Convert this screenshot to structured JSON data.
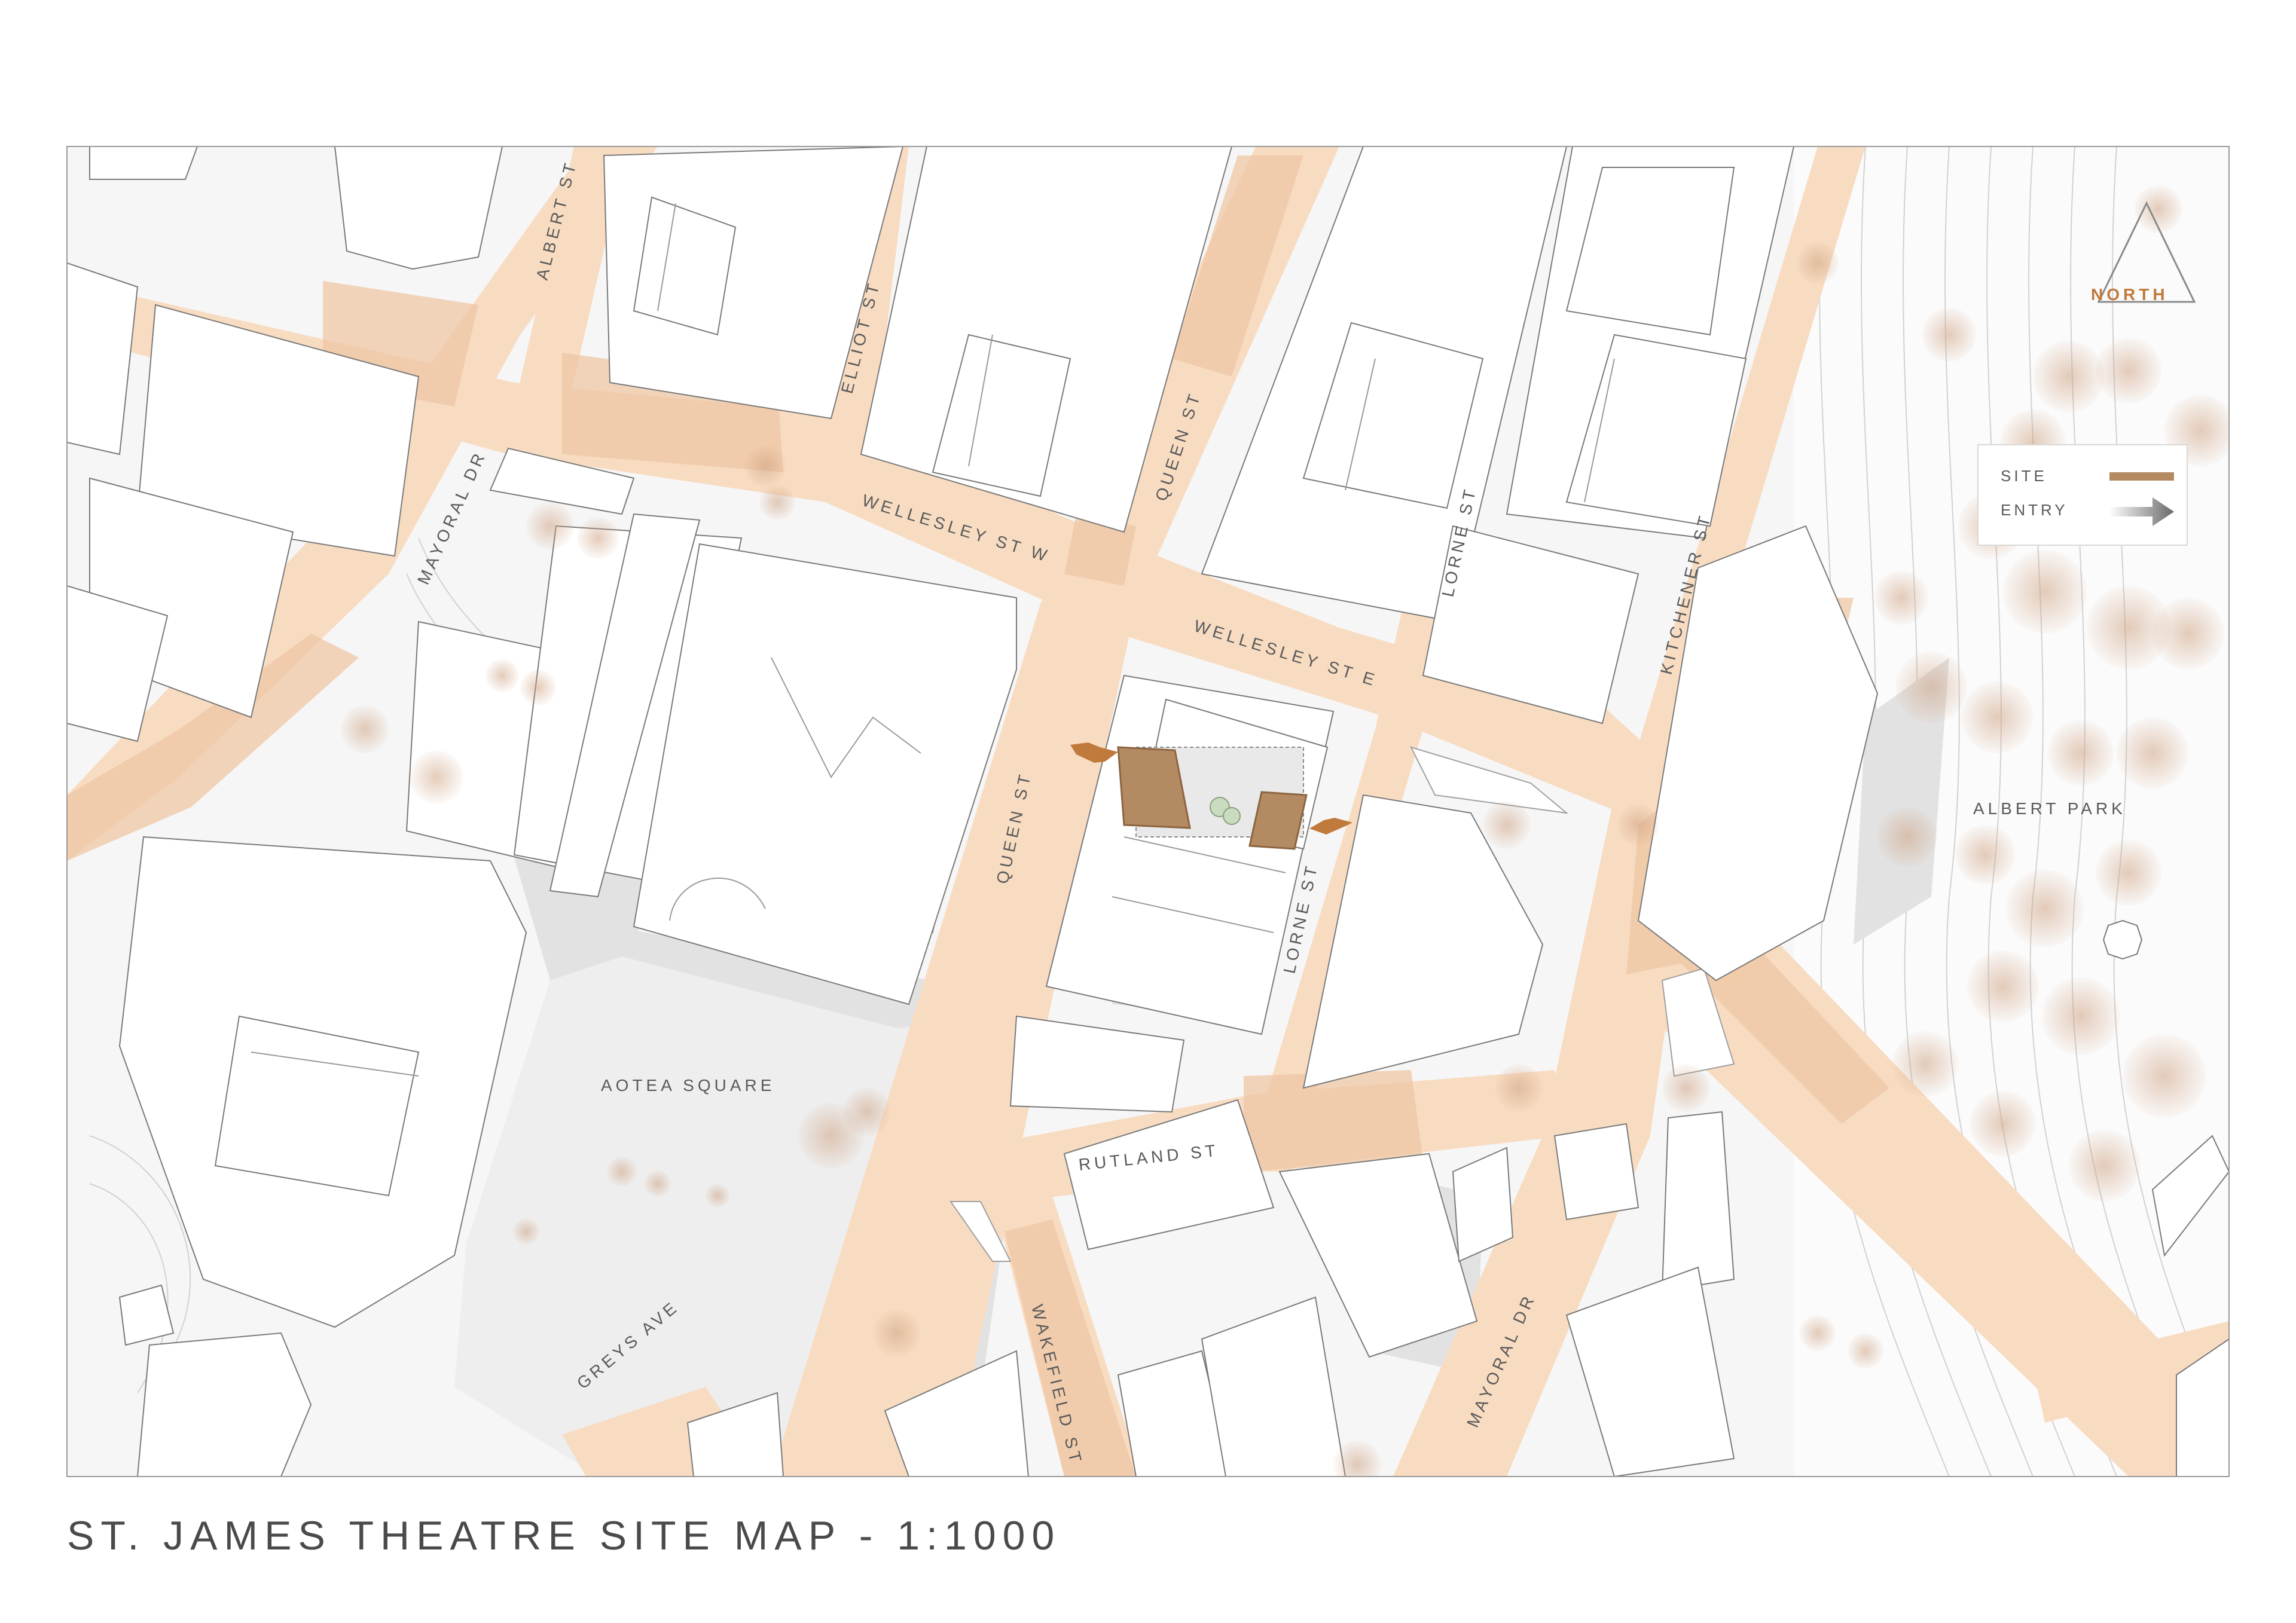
{
  "title": "ST. JAMES THEATRE SITE MAP - 1:1000",
  "north": "NORTH",
  "legend": {
    "site_label": "SITE",
    "entry_label": "ENTRY",
    "site_color": "#b48a63",
    "entry_color": "#7a7a7a"
  },
  "colors": {
    "road": "#f8dcc2",
    "road_emphasis": "#efc7a4",
    "building": "#ffffff",
    "shadow": "#dedede",
    "plaza": "#ececec",
    "tree": "#d9b79e",
    "accent": "#c07a3c"
  },
  "streets": {
    "albert": "ALBERT ST",
    "elliot": "ELLIOT ST",
    "queen_north": "QUEEN ST",
    "queen_south": "QUEEN ST",
    "lorne_north": "LORNE ST",
    "lorne_south": "LORNE ST",
    "kitchener": "KITCHENER ST",
    "mayoral_west": "MAYORAL DR",
    "mayoral_east": "MAYORAL DR",
    "wellesley_w": "WELLESLEY ST W",
    "wellesley_e": "WELLESLEY ST E",
    "rutland": "RUTLAND ST",
    "wakefield": "WAKEFIELD ST",
    "greys": "GREYS AVE"
  },
  "places": {
    "aotea": "AOTEA SQUARE",
    "albert_park": "ALBERT PARK"
  }
}
